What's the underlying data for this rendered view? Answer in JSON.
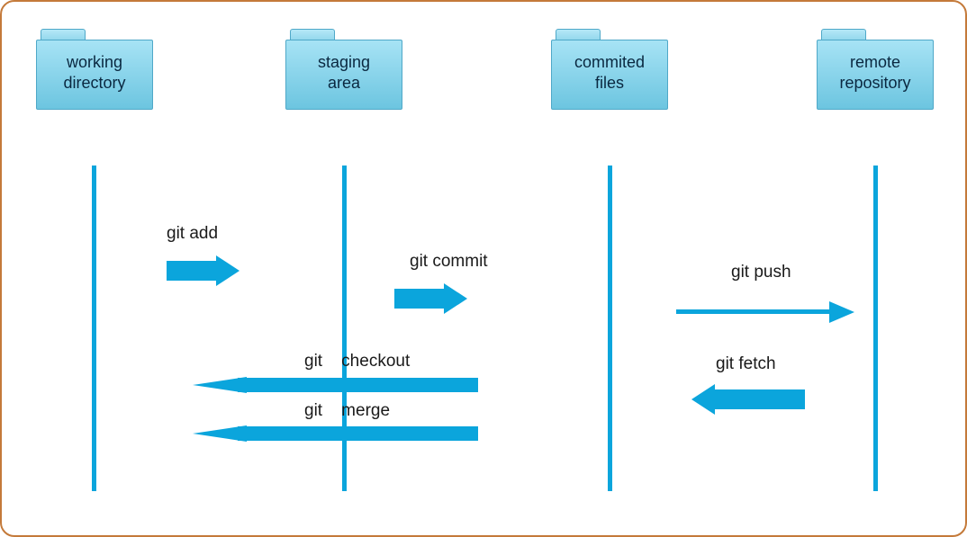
{
  "folders": {
    "working": "working\ndirectory",
    "staging": "staging\narea",
    "committed": "commited\nfiles",
    "remote": "remote\nrepository"
  },
  "commands": {
    "add": "git add",
    "commit": "git commit",
    "checkout": "git    checkout",
    "merge": "git    merge",
    "push": "git push",
    "fetch": "git fetch"
  }
}
